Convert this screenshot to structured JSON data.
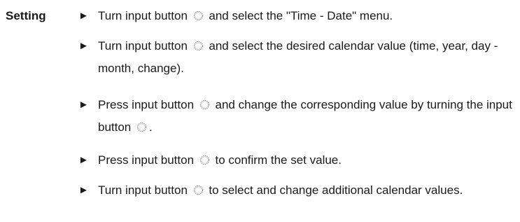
{
  "section": {
    "heading": "Setting"
  },
  "icons": {
    "bullet": "right-pointer-triangle",
    "input_button": "rotary-knob-icon"
  },
  "steps": [
    {
      "before": "Turn input button",
      "after": "and select the \"Time - Date\" menu."
    },
    {
      "before": "Turn input button",
      "after": "and select the desired calendar value (time, year, day - month, change)."
    },
    {
      "before": "Press input button",
      "middle": "and change the corresponding value by turning the input button",
      "after": "."
    },
    {
      "before": "Press input button",
      "after": "to confirm the set value."
    },
    {
      "before": "Turn input button",
      "after": "to select and change additional calendar values."
    }
  ]
}
